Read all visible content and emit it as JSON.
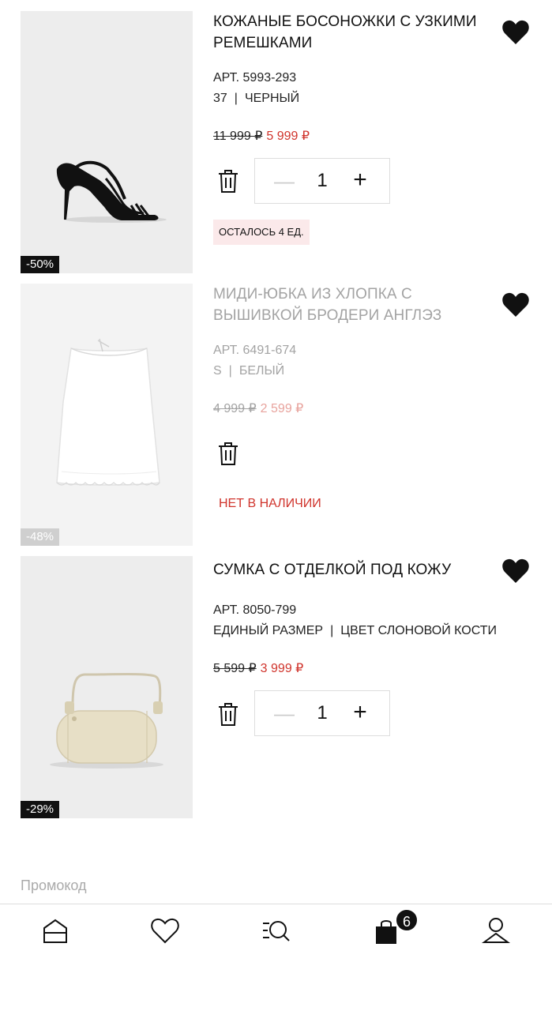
{
  "cart": {
    "items": [
      {
        "title": "КОЖАНЫЕ БОСОНОЖКИ С УЗКИМИ РЕМЕШКАМИ",
        "article": "АРТ. 5993-293",
        "size": "37",
        "color": "ЧЕРНЫЙ",
        "old_price": "11 999 ₽",
        "new_price": "5 999 ₽",
        "discount": "-50%",
        "quantity": "1",
        "stock_note": "ОСТАЛОСЬ 4 ЕД.",
        "image": "black-strappy-sandal"
      },
      {
        "title": "МИДИ-ЮБКА ИЗ ХЛОПКА С ВЫШИВКОЙ БРОДЕРИ АНГЛЭЗ",
        "article": "АРТ. 6491-674",
        "size": "S",
        "color": "БЕЛЫЙ",
        "old_price": "4 999 ₽",
        "new_price": "2 599 ₽",
        "discount": "-48%",
        "availability": "НЕТ В НАЛИЧИИ",
        "image": "white-midi-skirt"
      },
      {
        "title": "СУМКА С ОТДЕЛКОЙ ПОД КОЖУ",
        "article": "АРТ. 8050-799",
        "size": "ЕДИНЫЙ РАЗМЕР",
        "color": "ЦВЕТ СЛОНОВОЙ КОСТИ",
        "old_price": "5 599 ₽",
        "new_price": "3 999 ₽",
        "discount": "-29%",
        "quantity": "1",
        "image": "ivory-barrel-bag"
      }
    ]
  },
  "promo": {
    "label": "Промокод"
  },
  "nav": {
    "items": [
      "home-icon",
      "heart-icon",
      "search-menu-icon",
      "bag-icon",
      "user-icon"
    ],
    "cart_count": "6"
  },
  "colors": {
    "sale_red": "#d0342c",
    "stock_bg": "#fbe9ea",
    "text": "#111111"
  }
}
